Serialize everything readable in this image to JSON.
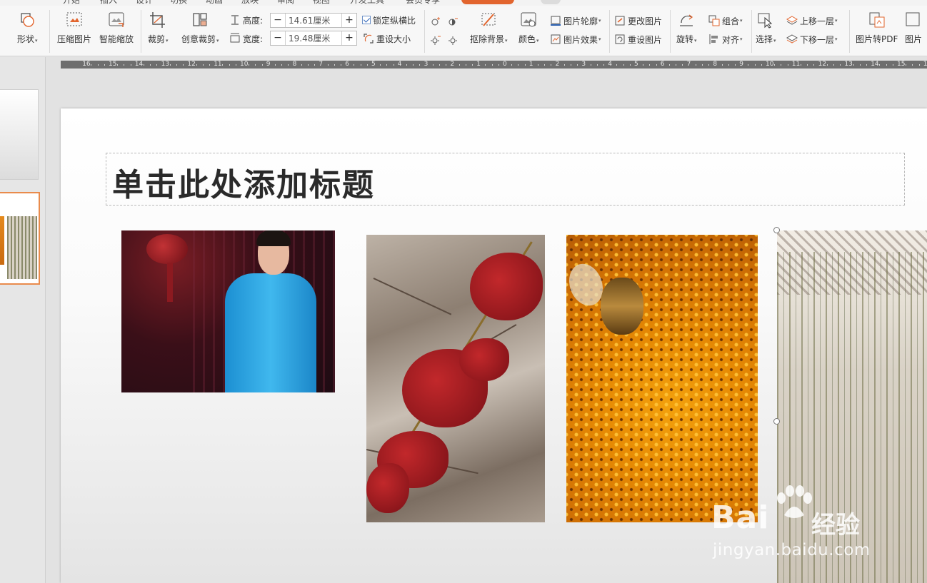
{
  "ribbon": {
    "shape": {
      "label": "形状"
    },
    "compress": {
      "label": "压缩图片"
    },
    "smart_zoom": {
      "label": "智能缩放"
    },
    "crop": {
      "label": "裁剪"
    },
    "creative_crop": {
      "label": "创意裁剪"
    },
    "height": {
      "label": "高度:",
      "value": "14.61厘米"
    },
    "width": {
      "label": "宽度:",
      "value": "19.48厘米"
    },
    "lock_ratio": {
      "label": "锁定纵横比",
      "checked": true
    },
    "reset_size": {
      "label": "重设大小"
    },
    "remove_bg": {
      "label": "抠除背景"
    },
    "color": {
      "label": "颜色"
    },
    "pic_outline": {
      "label": "图片轮廓"
    },
    "pic_effect": {
      "label": "图片效果"
    },
    "change_pic": {
      "label": "更改图片"
    },
    "reset_pic": {
      "label": "重设图片"
    },
    "rotate": {
      "label": "旋转"
    },
    "group": {
      "label": "组合"
    },
    "align": {
      "label": "对齐"
    },
    "select": {
      "label": "选择"
    },
    "bring_forward": {
      "label": "上移一层"
    },
    "send_backward": {
      "label": "下移一层"
    },
    "pic_to_pdf": {
      "label": "图片转PDF"
    },
    "pic_more": {
      "label": "图片"
    }
  },
  "ruler": {
    "ticks": [
      "16",
      "15",
      "14",
      "13",
      "12",
      "11",
      "10",
      "9",
      "8",
      "7",
      "6",
      "5",
      "4",
      "3",
      "2",
      "1",
      "0",
      "1",
      "2",
      "3",
      "4",
      "5",
      "6",
      "7",
      "8",
      "9",
      "10",
      "11",
      "12",
      "13",
      "14",
      "15",
      "16"
    ]
  },
  "slide": {
    "title_placeholder": "单击此处添加标题"
  },
  "watermark": {
    "brand": "Bai",
    "brand_suffix": "经验",
    "url": "jingyan.baidu.com"
  },
  "colors": {
    "accent": "#e2652e",
    "thumb_border": "#e98b4c"
  }
}
